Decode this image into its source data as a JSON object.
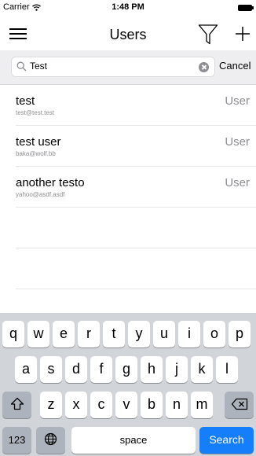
{
  "status_bar": {
    "carrier": "Carrier",
    "time": "1:48 PM"
  },
  "nav": {
    "title": "Users"
  },
  "search": {
    "value": "Test",
    "cancel_label": "Cancel"
  },
  "users": [
    {
      "name": "test",
      "email": "test@test.test",
      "role": "User"
    },
    {
      "name": "test user",
      "email": "baka@wolf.bb",
      "role": "User"
    },
    {
      "name": "another testo",
      "email": "yahoo@asdf.asdf",
      "role": "User"
    }
  ],
  "keyboard": {
    "row1": [
      "q",
      "w",
      "e",
      "r",
      "t",
      "y",
      "u",
      "i",
      "o",
      "p"
    ],
    "row2": [
      "a",
      "s",
      "d",
      "f",
      "g",
      "h",
      "j",
      "k",
      "l"
    ],
    "row3": [
      "z",
      "x",
      "c",
      "v",
      "b",
      "n",
      "m"
    ],
    "numbers_label": "123",
    "space_label": "space",
    "search_label": "Search",
    "search_key_color": "#147efb"
  }
}
